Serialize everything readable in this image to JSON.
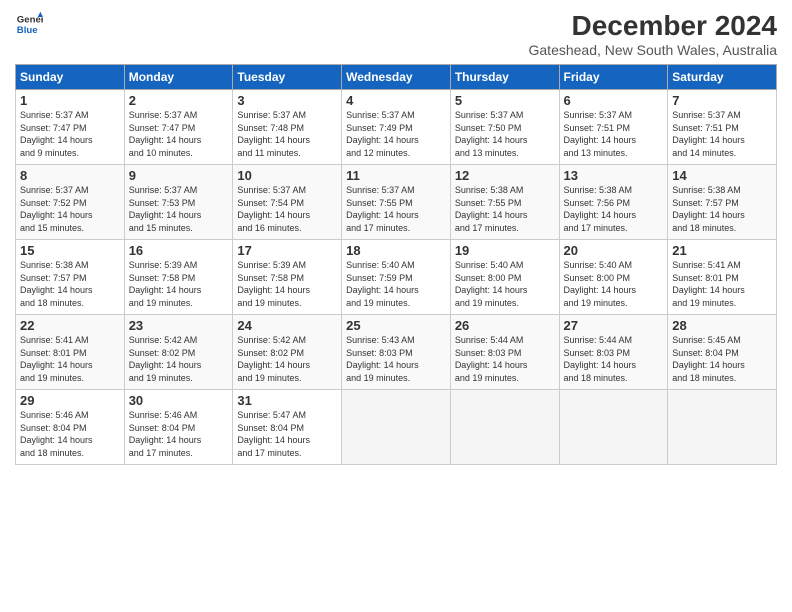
{
  "header": {
    "logo_line1": "General",
    "logo_line2": "Blue",
    "title": "December 2024",
    "subtitle": "Gateshead, New South Wales, Australia"
  },
  "days_of_week": [
    "Sunday",
    "Monday",
    "Tuesday",
    "Wednesday",
    "Thursday",
    "Friday",
    "Saturday"
  ],
  "weeks": [
    [
      {
        "num": "1",
        "info": "Sunrise: 5:37 AM\nSunset: 7:47 PM\nDaylight: 14 hours\nand 9 minutes."
      },
      {
        "num": "2",
        "info": "Sunrise: 5:37 AM\nSunset: 7:47 PM\nDaylight: 14 hours\nand 10 minutes."
      },
      {
        "num": "3",
        "info": "Sunrise: 5:37 AM\nSunset: 7:48 PM\nDaylight: 14 hours\nand 11 minutes."
      },
      {
        "num": "4",
        "info": "Sunrise: 5:37 AM\nSunset: 7:49 PM\nDaylight: 14 hours\nand 12 minutes."
      },
      {
        "num": "5",
        "info": "Sunrise: 5:37 AM\nSunset: 7:50 PM\nDaylight: 14 hours\nand 13 minutes."
      },
      {
        "num": "6",
        "info": "Sunrise: 5:37 AM\nSunset: 7:51 PM\nDaylight: 14 hours\nand 13 minutes."
      },
      {
        "num": "7",
        "info": "Sunrise: 5:37 AM\nSunset: 7:51 PM\nDaylight: 14 hours\nand 14 minutes."
      }
    ],
    [
      {
        "num": "8",
        "info": "Sunrise: 5:37 AM\nSunset: 7:52 PM\nDaylight: 14 hours\nand 15 minutes."
      },
      {
        "num": "9",
        "info": "Sunrise: 5:37 AM\nSunset: 7:53 PM\nDaylight: 14 hours\nand 15 minutes."
      },
      {
        "num": "10",
        "info": "Sunrise: 5:37 AM\nSunset: 7:54 PM\nDaylight: 14 hours\nand 16 minutes."
      },
      {
        "num": "11",
        "info": "Sunrise: 5:37 AM\nSunset: 7:55 PM\nDaylight: 14 hours\nand 17 minutes."
      },
      {
        "num": "12",
        "info": "Sunrise: 5:38 AM\nSunset: 7:55 PM\nDaylight: 14 hours\nand 17 minutes."
      },
      {
        "num": "13",
        "info": "Sunrise: 5:38 AM\nSunset: 7:56 PM\nDaylight: 14 hours\nand 17 minutes."
      },
      {
        "num": "14",
        "info": "Sunrise: 5:38 AM\nSunset: 7:57 PM\nDaylight: 14 hours\nand 18 minutes."
      }
    ],
    [
      {
        "num": "15",
        "info": "Sunrise: 5:38 AM\nSunset: 7:57 PM\nDaylight: 14 hours\nand 18 minutes."
      },
      {
        "num": "16",
        "info": "Sunrise: 5:39 AM\nSunset: 7:58 PM\nDaylight: 14 hours\nand 19 minutes."
      },
      {
        "num": "17",
        "info": "Sunrise: 5:39 AM\nSunset: 7:58 PM\nDaylight: 14 hours\nand 19 minutes."
      },
      {
        "num": "18",
        "info": "Sunrise: 5:40 AM\nSunset: 7:59 PM\nDaylight: 14 hours\nand 19 minutes."
      },
      {
        "num": "19",
        "info": "Sunrise: 5:40 AM\nSunset: 8:00 PM\nDaylight: 14 hours\nand 19 minutes."
      },
      {
        "num": "20",
        "info": "Sunrise: 5:40 AM\nSunset: 8:00 PM\nDaylight: 14 hours\nand 19 minutes."
      },
      {
        "num": "21",
        "info": "Sunrise: 5:41 AM\nSunset: 8:01 PM\nDaylight: 14 hours\nand 19 minutes."
      }
    ],
    [
      {
        "num": "22",
        "info": "Sunrise: 5:41 AM\nSunset: 8:01 PM\nDaylight: 14 hours\nand 19 minutes."
      },
      {
        "num": "23",
        "info": "Sunrise: 5:42 AM\nSunset: 8:02 PM\nDaylight: 14 hours\nand 19 minutes."
      },
      {
        "num": "24",
        "info": "Sunrise: 5:42 AM\nSunset: 8:02 PM\nDaylight: 14 hours\nand 19 minutes."
      },
      {
        "num": "25",
        "info": "Sunrise: 5:43 AM\nSunset: 8:03 PM\nDaylight: 14 hours\nand 19 minutes."
      },
      {
        "num": "26",
        "info": "Sunrise: 5:44 AM\nSunset: 8:03 PM\nDaylight: 14 hours\nand 19 minutes."
      },
      {
        "num": "27",
        "info": "Sunrise: 5:44 AM\nSunset: 8:03 PM\nDaylight: 14 hours\nand 18 minutes."
      },
      {
        "num": "28",
        "info": "Sunrise: 5:45 AM\nSunset: 8:04 PM\nDaylight: 14 hours\nand 18 minutes."
      }
    ],
    [
      {
        "num": "29",
        "info": "Sunrise: 5:46 AM\nSunset: 8:04 PM\nDaylight: 14 hours\nand 18 minutes."
      },
      {
        "num": "30",
        "info": "Sunrise: 5:46 AM\nSunset: 8:04 PM\nDaylight: 14 hours\nand 17 minutes."
      },
      {
        "num": "31",
        "info": "Sunrise: 5:47 AM\nSunset: 8:04 PM\nDaylight: 14 hours\nand 17 minutes."
      },
      null,
      null,
      null,
      null
    ]
  ]
}
